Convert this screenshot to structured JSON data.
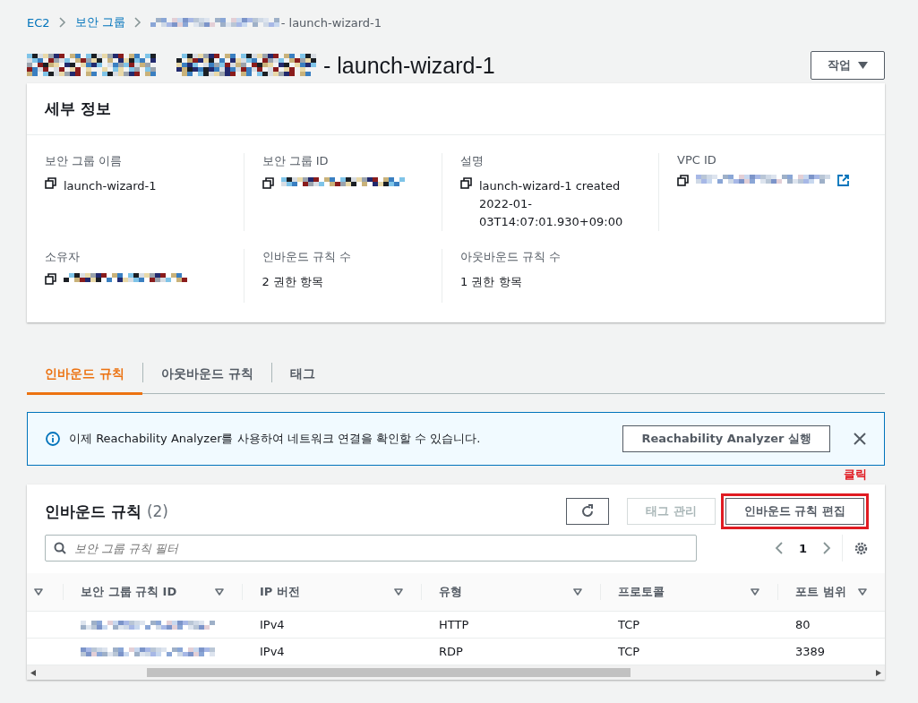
{
  "breadcrumb": [
    {
      "label": "EC2",
      "link": true,
      "redacted": false
    },
    {
      "label": "보안 그룹",
      "link": true,
      "redacted": false
    },
    {
      "label": "- launch-wizard-1",
      "link": false,
      "redacted": true
    }
  ],
  "page_title": {
    "text": "- launch-wizard-1",
    "redacted": true
  },
  "actions_button": "작업",
  "details": {
    "title": "세부 정보",
    "fields": [
      {
        "label": "보안 그룹 이름",
        "value": "launch-wizard-1",
        "copy": true,
        "redacted": false,
        "external": false
      },
      {
        "label": "보안 그룹 ID",
        "copy": true,
        "redacted": true,
        "external": false
      },
      {
        "label": "설명",
        "value": "launch-wizard-1 created 2022-01-03T14:07:01.930+09:00",
        "copy": true,
        "redacted": false,
        "external": false
      },
      {
        "label": "VPC ID",
        "copy": true,
        "redacted": true,
        "external": true
      },
      {
        "label": "소유자",
        "copy": true,
        "redacted": true,
        "external": false
      },
      {
        "label": "인바운드 규칙 수",
        "value": "2 권한 항목",
        "copy": false,
        "redacted": false,
        "external": false
      },
      {
        "label": "아웃바운드 규칙 수",
        "value": "1 권한 항목",
        "copy": false,
        "redacted": false,
        "external": false
      }
    ]
  },
  "tabs": [
    {
      "label": "인바운드 규칙",
      "selected": true
    },
    {
      "label": "아웃바운드 규칙",
      "selected": false
    },
    {
      "label": "태그",
      "selected": false
    }
  ],
  "banner": {
    "text": "이제 Reachability Analyzer를 사용하여 네트워크 연결을 확인할 수 있습니다.",
    "button": "Reachability Analyzer 실행"
  },
  "rules_panel": {
    "title": "인바운드 규칙",
    "count": "(2)",
    "annotation": "클릭",
    "buttons": [
      {
        "label": "태그 관리",
        "disabled": true,
        "highlighted": false
      },
      {
        "label": "인바운드 규칙 편집",
        "disabled": false,
        "highlighted": true
      }
    ],
    "filter_placeholder": "보안 그룹 규칙 필터",
    "page": "1",
    "columns": [
      "",
      "보안 그룹 규칙 ID",
      "IP 버전",
      "유형",
      "프로토콜",
      "포트 범위"
    ],
    "rows": [
      {
        "cells": [
          "",
          "",
          "IPv4",
          "HTTP",
          "TCP",
          "80"
        ]
      },
      {
        "cells": [
          "",
          "",
          "IPv4",
          "RDP",
          "TCP",
          "3389"
        ]
      }
    ]
  }
}
